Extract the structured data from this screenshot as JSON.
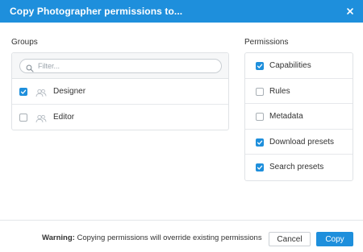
{
  "dialog": {
    "title": "Copy Photographer permissions to...",
    "close_icon": "close-icon",
    "accent_color": "#1e8fdc"
  },
  "groups": {
    "label": "Groups",
    "filter_placeholder": "Filter...",
    "filter_value": "",
    "items": [
      {
        "label": "Designer",
        "checked": true,
        "icon": "user-group-icon"
      },
      {
        "label": "Editor",
        "checked": false,
        "icon": "user-group-icon"
      }
    ]
  },
  "permissions": {
    "label": "Permissions",
    "items": [
      {
        "label": "Capabilities",
        "checked": true
      },
      {
        "label": "Rules",
        "checked": false
      },
      {
        "label": "Metadata",
        "checked": false
      },
      {
        "label": "Download presets",
        "checked": true
      },
      {
        "label": "Search presets",
        "checked": true
      }
    ]
  },
  "footer": {
    "warning_prefix": "Warning:",
    "warning_text": "Copying permissions will override existing permissions",
    "cancel_label": "Cancel",
    "copy_label": "Copy"
  }
}
